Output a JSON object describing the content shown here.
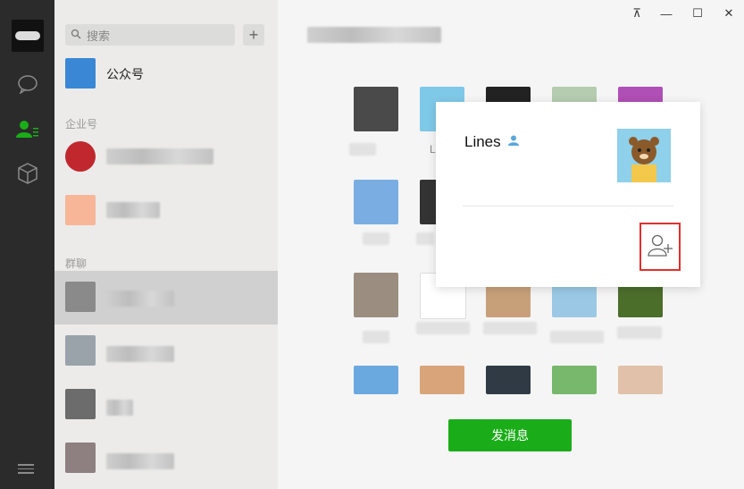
{
  "sidebar": {
    "search_placeholder": "搜索",
    "add_label": "+",
    "official_accounts_label": "公众号",
    "section_enterprise": "企业号",
    "section_groups": "群聊"
  },
  "window": {
    "pin": "⊼",
    "minimize": "—",
    "maximize": "☐",
    "close": "✕"
  },
  "main": {
    "send_button_label": "发消息",
    "grid_fragment": "L"
  },
  "profile_card": {
    "name": "Lines"
  },
  "colors": {
    "accent_green": "#1aad19",
    "highlight_red": "#e0312f"
  }
}
